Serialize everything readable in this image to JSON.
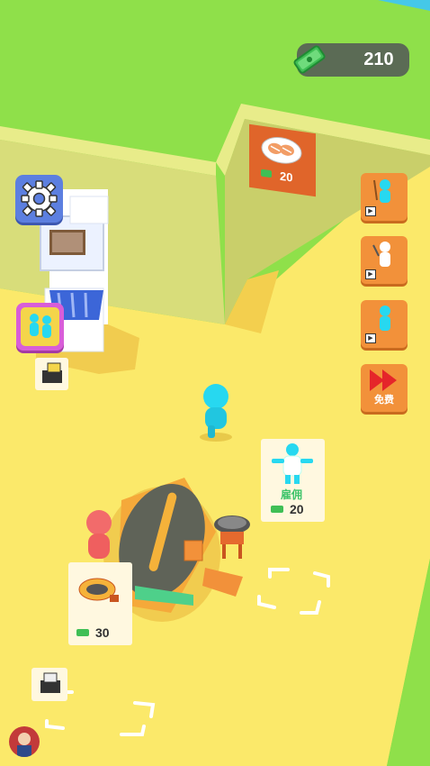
{
  "hud": {
    "money": "210",
    "money_icon": "cash-icon",
    "settings_icon": "gear-icon"
  },
  "wall_sign": {
    "dish_icon": "salmon-sushi-plate-icon",
    "price": "20"
  },
  "side_buttons": [
    {
      "name": "recruit-chef-button",
      "icon": "worker-with-fork-icon",
      "ad": "▶"
    },
    {
      "name": "recruit-waiter-button",
      "icon": "worker-with-knife-icon",
      "ad": "▶"
    },
    {
      "name": "upgrade-worker-button",
      "icon": "worker-icon",
      "ad": "▶"
    },
    {
      "name": "speed-up-button",
      "icon": "fast-forward-icon",
      "label": "免费"
    }
  ],
  "left_buttons": [
    {
      "name": "staff-upgrade-button",
      "icon": "two-workers-icon"
    },
    {
      "name": "cash-register-item",
      "icon": "register-icon"
    }
  ],
  "hire_card": {
    "label": "雇佣",
    "price": "20"
  },
  "conveyor_card": {
    "price": "30"
  },
  "colors": {
    "grass": "#8fe04a",
    "floor": "#fbe96a",
    "wall": "#d8dd7a",
    "accent_orange": "#f2913a",
    "player": "#27d8f0",
    "npc": "#f26b6b"
  }
}
